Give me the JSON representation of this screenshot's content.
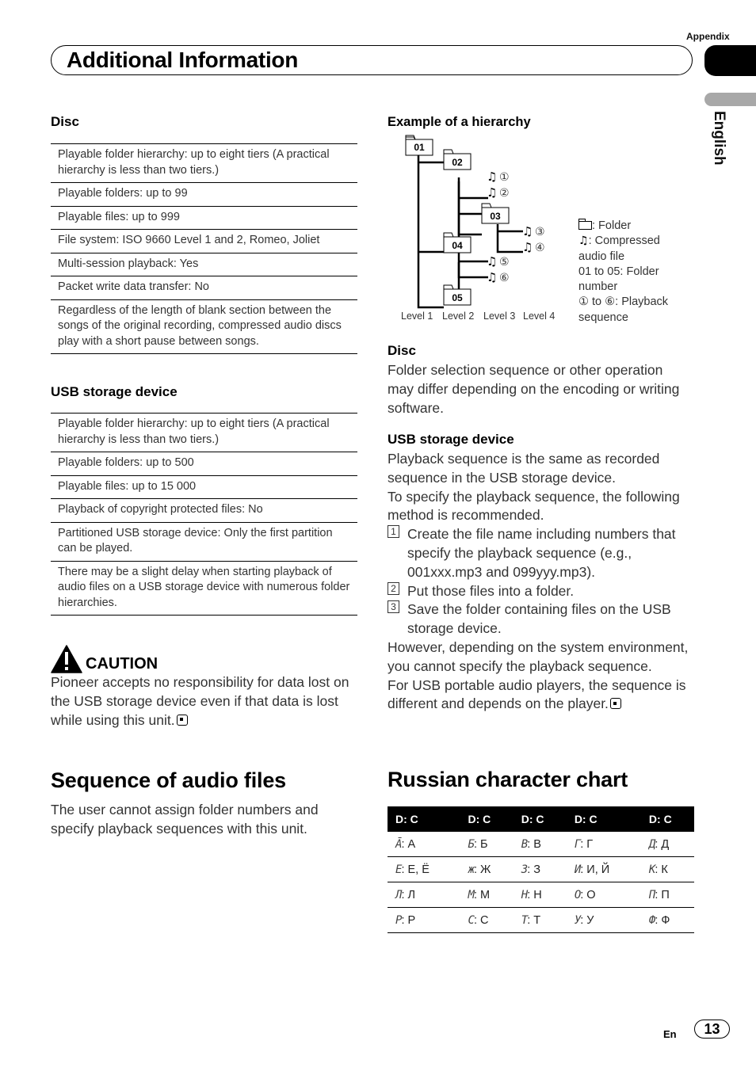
{
  "header": {
    "appendix": "Appendix",
    "title": "Additional Information",
    "language_tab": "English"
  },
  "left": {
    "disc": {
      "heading": "Disc",
      "rows": [
        "Playable folder hierarchy: up to eight tiers (A practical hierarchy is less than two tiers.)",
        "Playable folders: up to 99",
        "Playable files: up to 999",
        "File system: ISO 9660 Level 1 and 2, Romeo, Joliet",
        "Multi-session playback: Yes",
        "Packet write data transfer: No",
        "Regardless of the length of blank section between the songs of the original recording, compressed audio discs play with a short pause between songs."
      ]
    },
    "usb": {
      "heading": "USB storage device",
      "rows": [
        "Playable folder hierarchy: up to eight tiers (A practical hierarchy is less than two tiers.)",
        "Playable folders: up to 500",
        "Playable files: up to 15 000",
        "Playback of copyright protected files: No",
        "Partitioned USB storage device: Only the first partition can be played.",
        "There may be a slight delay when starting playback of audio files on a USB storage device with numerous folder hierarchies."
      ]
    },
    "caution": {
      "label": "CAUTION",
      "text": "Pioneer accepts no responsibility for data lost on the USB storage device even if that data is lost while using this unit."
    },
    "sequence": {
      "heading": "Sequence of audio files",
      "text": "The user cannot assign folder numbers and specify playback sequences with this unit."
    }
  },
  "right": {
    "hierarchy": {
      "heading": "Example of a hierarchy",
      "folders": [
        "01",
        "02",
        "03",
        "04",
        "05"
      ],
      "files": [
        "①",
        "②",
        "③",
        "④",
        "⑤",
        "⑥"
      ],
      "levels": [
        "Level 1",
        "Level 2",
        "Level 3",
        "Level 4"
      ],
      "legend": {
        "folder": ": Folder",
        "file": ": Compressed audio file",
        "folder_numbers": "01 to 05: Folder number",
        "sequence": "① to ⑥: Playback sequence"
      }
    },
    "disc": {
      "heading": "Disc",
      "text": "Folder selection sequence or other operation may differ depending on the encoding or writing software."
    },
    "usb": {
      "heading": "USB storage device",
      "intro1": "Playback sequence is the same as recorded sequence in the USB storage device.",
      "intro2": "To specify the playback sequence, the following method is recommended.",
      "steps": [
        {
          "num": "1",
          "text": "Create the file name including numbers that specify the playback sequence (e.g., 001xxx.mp3 and 099yyy.mp3)."
        },
        {
          "num": "2",
          "text": "Put those files into a folder."
        },
        {
          "num": "3",
          "text": "Save the folder containing files on the USB storage device."
        }
      ],
      "outro1": "However, depending on the system environment, you cannot specify the playback sequence.",
      "outro2": "For USB portable audio players, the sequence is different and depends on the player."
    },
    "russian": {
      "heading": "Russian character chart",
      "header": [
        "D: C",
        "D: C",
        "D: C",
        "D: C",
        "D: C"
      ],
      "rows": [
        [
          {
            "d": "Ᾱ",
            "c": ": А"
          },
          {
            "d": "Б",
            "c": ": Б"
          },
          {
            "d": "В",
            "c": ": В"
          },
          {
            "d": "Г",
            "c": ": Г"
          },
          {
            "d": "Д",
            "c": ": Д"
          }
        ],
        [
          {
            "d": "Е",
            "c": ": Е, Ё"
          },
          {
            "d": "ж",
            "c": ": Ж"
          },
          {
            "d": "З",
            "c": ": З"
          },
          {
            "d": "И",
            "c": ": И, Й"
          },
          {
            "d": "К",
            "c": ": К"
          }
        ],
        [
          {
            "d": "Л",
            "c": ": Л"
          },
          {
            "d": "М",
            "c": ": М"
          },
          {
            "d": "Н",
            "c": ": Н"
          },
          {
            "d": "О",
            "c": ": О"
          },
          {
            "d": "П",
            "c": ": П"
          }
        ],
        [
          {
            "d": "Р",
            "c": ": Р"
          },
          {
            "d": "С",
            "c": ": С"
          },
          {
            "d": "Т",
            "c": ": Т"
          },
          {
            "d": "У",
            "c": ": У"
          },
          {
            "d": "Ф",
            "c": ": Ф"
          }
        ]
      ]
    }
  },
  "footer": {
    "lang_code": "En",
    "page_number": "13"
  }
}
